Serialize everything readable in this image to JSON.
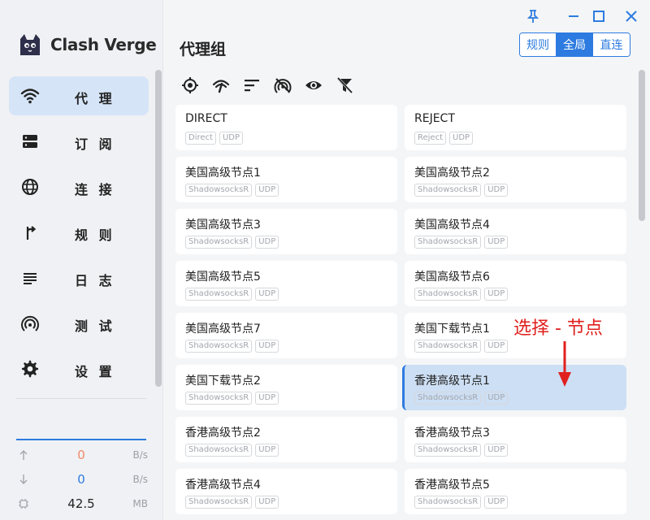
{
  "app": {
    "name": "Clash Verge"
  },
  "window": {
    "pin": "pin-icon",
    "minimize": "minimize-icon",
    "maximize": "maximize-icon",
    "close": "close-icon"
  },
  "sidebar": {
    "items": [
      {
        "label": "代 理",
        "icon": "wifi-icon"
      },
      {
        "label": "订 阅",
        "icon": "server-icon"
      },
      {
        "label": "连 接",
        "icon": "globe-icon"
      },
      {
        "label": "规 则",
        "icon": "fork-icon"
      },
      {
        "label": "日 志",
        "icon": "lines-icon"
      },
      {
        "label": "测 试",
        "icon": "signal-icon"
      },
      {
        "label": "设 置",
        "icon": "gear-icon"
      }
    ],
    "traffic": {
      "up": {
        "value": "0",
        "unit": "B/s"
      },
      "down": {
        "value": "0",
        "unit": "B/s"
      },
      "memory": {
        "value": "42.5",
        "unit": "MB"
      }
    }
  },
  "header": {
    "title": "代理组",
    "modes": [
      "规则",
      "全局",
      "直连"
    ],
    "active_mode": "全局"
  },
  "proxies": [
    {
      "name": "DIRECT",
      "tags": [
        "Direct",
        "UDP"
      ]
    },
    {
      "name": "REJECT",
      "tags": [
        "Reject",
        "UDP"
      ]
    },
    {
      "name": "美国高级节点1",
      "tags": [
        "ShadowsocksR",
        "UDP"
      ]
    },
    {
      "name": "美国高级节点2",
      "tags": [
        "ShadowsocksR",
        "UDP"
      ]
    },
    {
      "name": "美国高级节点3",
      "tags": [
        "ShadowsocksR",
        "UDP"
      ]
    },
    {
      "name": "美国高级节点4",
      "tags": [
        "ShadowsocksR",
        "UDP"
      ]
    },
    {
      "name": "美国高级节点5",
      "tags": [
        "ShadowsocksR",
        "UDP"
      ]
    },
    {
      "name": "美国高级节点6",
      "tags": [
        "ShadowsocksR",
        "UDP"
      ]
    },
    {
      "name": "美国高级节点7",
      "tags": [
        "ShadowsocksR",
        "UDP"
      ]
    },
    {
      "name": "美国下载节点1",
      "tags": [
        "ShadowsocksR",
        "UDP"
      ]
    },
    {
      "name": "美国下载节点2",
      "tags": [
        "ShadowsocksR",
        "UDP"
      ]
    },
    {
      "name": "香港高级节点1",
      "tags": [
        "ShadowsocksR",
        "UDP"
      ],
      "selected": true
    },
    {
      "name": "香港高级节点2",
      "tags": [
        "ShadowsocksR",
        "UDP"
      ]
    },
    {
      "name": "香港高级节点3",
      "tags": [
        "ShadowsocksR",
        "UDP"
      ]
    },
    {
      "name": "香港高级节点4",
      "tags": [
        "ShadowsocksR",
        "UDP"
      ]
    },
    {
      "name": "香港高级节点5",
      "tags": [
        "ShadowsocksR",
        "UDP"
      ]
    }
  ],
  "annotation": {
    "text": "选择 - 节点",
    "color": "#e0201e"
  },
  "colors": {
    "accent": "#2d7be0",
    "active_nav": "#d6e4f7",
    "selected_card": "#cddff4"
  }
}
